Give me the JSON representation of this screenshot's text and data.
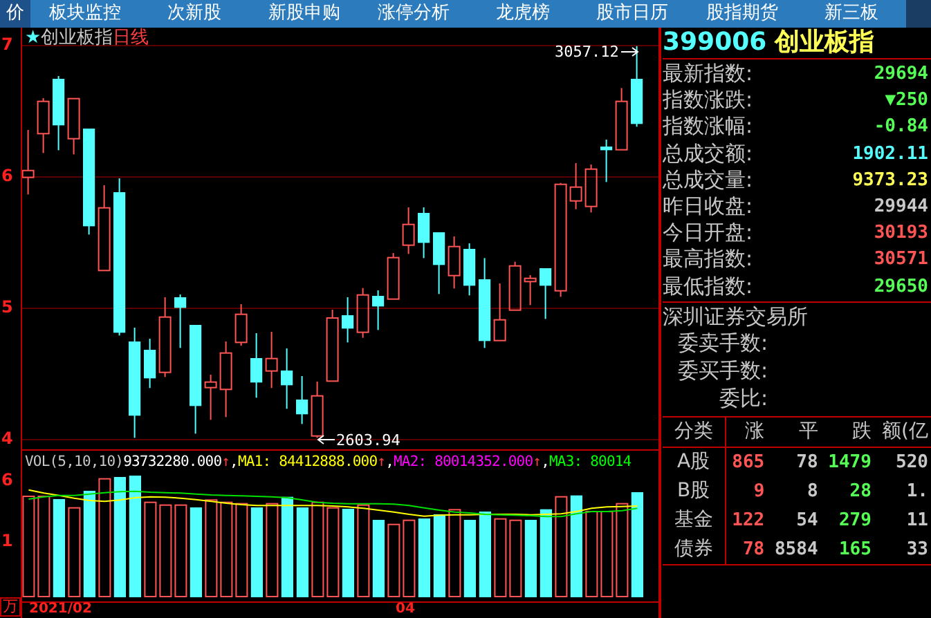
{
  "nav": [
    {
      "label": "价",
      "selected": true
    },
    {
      "label": "板块监控",
      "selected": false
    },
    {
      "label": "次新股",
      "selected": false
    },
    {
      "label": "新股申购",
      "selected": false
    },
    {
      "label": "涨停分析",
      "selected": false
    },
    {
      "label": "龙虎榜",
      "selected": false
    },
    {
      "label": "股市日历",
      "selected": false
    },
    {
      "label": "股指期货",
      "selected": false
    },
    {
      "label": "新三板",
      "selected": false
    }
  ],
  "chart": {
    "star": "★",
    "name": "创业板指",
    "period": "日线",
    "y_labels": [
      "7",
      "6",
      "5",
      "4"
    ],
    "high_marker": "3057.12",
    "low_marker": "2603.94"
  },
  "volume": {
    "y_labels": [
      "6",
      "1"
    ],
    "unit": "万",
    "legend": [
      {
        "text": "VOL(5,10,10)",
        "color": "#c8c8c8"
      },
      {
        "text": "93732280.000",
        "color": "#ffffff"
      },
      {
        "text": "↑",
        "color": "#ff4040"
      },
      {
        "text": ",",
        "color": "#ffffff"
      },
      {
        "text": "MA1: 84412888.000",
        "color": "#ffff00"
      },
      {
        "text": "↑",
        "color": "#ff4040"
      },
      {
        "text": ",",
        "color": "#ffffff"
      },
      {
        "text": "MA2: 80014352.000",
        "color": "#ff00ff"
      },
      {
        "text": "↑",
        "color": "#ff4040"
      },
      {
        "text": ",",
        "color": "#ffffff"
      },
      {
        "text": "MA3: 80014",
        "color": "#00ff00"
      }
    ]
  },
  "dates": [
    "2021/02",
    "04"
  ],
  "quote": {
    "code": "399006",
    "name": "创业板指",
    "rows": [
      {
        "label": "最新指数:",
        "value": "29694",
        "color": "#55ff55"
      },
      {
        "label": "指数涨跌:",
        "value": "▼250",
        "color": "#55ff55"
      },
      {
        "label": "指数涨幅:",
        "value": "-0.84",
        "color": "#55ff55"
      },
      {
        "label": "总成交额:",
        "value": "1902.11",
        "color": "#55ffff"
      },
      {
        "label": "总成交量:",
        "value": "9373.23",
        "color": "#ffff55"
      },
      {
        "label": "昨日收盘:",
        "value": "29944",
        "color": "#c8c8c8"
      },
      {
        "label": "今日开盘:",
        "value": "30193",
        "color": "#ff5555"
      },
      {
        "label": "最高指数:",
        "value": "30571",
        "color": "#ff5555"
      },
      {
        "label": "最低指数:",
        "value": "29650",
        "color": "#55ff55"
      }
    ]
  },
  "exchange": {
    "name": "深圳证券交易所",
    "rows": [
      "委卖手数:",
      "委买手数:",
      "委比:"
    ]
  },
  "breadth": {
    "columns": [
      "分类",
      "涨",
      "平",
      "跌",
      "额(亿"
    ],
    "rows": [
      [
        "A股",
        "865",
        "78",
        "1479",
        "520"
      ],
      [
        "B股",
        "9",
        "8",
        "28",
        "1."
      ],
      [
        "基金",
        "122",
        "54",
        "279",
        "11"
      ],
      [
        "债券",
        "78",
        "8584",
        "165",
        "33"
      ]
    ]
  }
}
